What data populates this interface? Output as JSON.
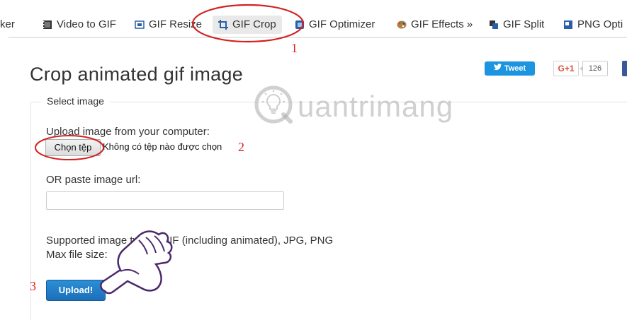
{
  "nav": {
    "items": [
      {
        "label": "ker",
        "icon": "none"
      },
      {
        "label": "Video to GIF",
        "icon": "film-icon"
      },
      {
        "label": "GIF Resize",
        "icon": "resize-icon"
      },
      {
        "label": "GIF Crop",
        "icon": "crop-icon",
        "active": true
      },
      {
        "label": "GIF Optimizer",
        "icon": "optimizer-icon"
      },
      {
        "label": "GIF Effects »",
        "icon": "palette-icon"
      },
      {
        "label": "GIF Split",
        "icon": "split-icon"
      },
      {
        "label": "PNG Opti",
        "icon": "png-icon"
      }
    ]
  },
  "page": {
    "title": "Crop animated gif image"
  },
  "social": {
    "tweet_label": "Tweet",
    "gplus_label": "G+1",
    "gplus_count": "126"
  },
  "form": {
    "legend": "Select image",
    "upload_label": "Upload image from your computer:",
    "file_button": "Chọn tệp",
    "file_status": "Không có tệp nào được chọn",
    "url_label": "OR paste image url:",
    "url_value": "",
    "supported_text": "Supported image types: GIF (including animated), JPG, PNG",
    "max_size_text": "Max file size: ",
    "upload_button": "Upload!"
  },
  "annotations": {
    "step1": "1",
    "step2": "2",
    "step3": "3",
    "color": "#d22222"
  },
  "watermark": {
    "text": "uantrimang"
  }
}
